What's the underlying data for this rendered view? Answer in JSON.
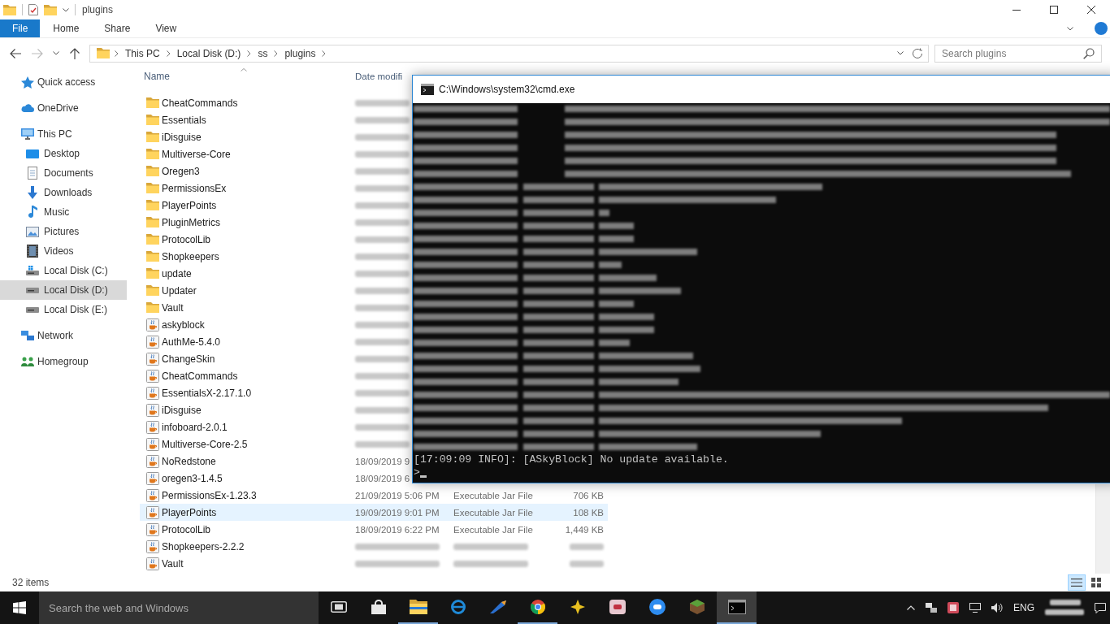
{
  "explorer": {
    "title": "plugins",
    "ribbon_tabs": [
      {
        "label": "File",
        "selected": true
      },
      {
        "label": "Home",
        "selected": false
      },
      {
        "label": "Share",
        "selected": false
      },
      {
        "label": "View",
        "selected": false
      }
    ],
    "address_path": [
      "This PC",
      "Local Disk (D:)",
      "ss",
      "plugins"
    ],
    "search": {
      "placeholder": "Search plugins"
    },
    "navigation": [
      {
        "label": "Quick access",
        "kind": "star",
        "selected": false
      },
      {
        "label": "OneDrive",
        "kind": "cloud",
        "selected": false
      },
      {
        "label": "This PC",
        "kind": "computer",
        "selected": false,
        "children": [
          {
            "label": "Desktop",
            "kind": "desktop",
            "selected": false
          },
          {
            "label": "Documents",
            "kind": "documents",
            "selected": false
          },
          {
            "label": "Downloads",
            "kind": "downloads",
            "selected": false
          },
          {
            "label": "Music",
            "kind": "music",
            "selected": false
          },
          {
            "label": "Pictures",
            "kind": "pictures",
            "selected": false
          },
          {
            "label": "Videos",
            "kind": "videos",
            "selected": false
          },
          {
            "label": "Local Disk (C:)",
            "kind": "system-drive",
            "selected": false
          },
          {
            "label": "Local Disk (D:)",
            "kind": "drive",
            "selected": true
          },
          {
            "label": "Local Disk (E:)",
            "kind": "drive",
            "selected": false
          }
        ]
      },
      {
        "label": "Network",
        "kind": "network",
        "selected": false
      },
      {
        "label": "Homegroup",
        "kind": "homegroup",
        "selected": false
      }
    ],
    "file_list": {
      "columns": [
        "Name",
        "Date modifi"
      ],
      "rows": [
        {
          "name": "CheatCommands",
          "kind": "folder",
          "selected": false
        },
        {
          "name": "Essentials",
          "kind": "folder",
          "selected": false
        },
        {
          "name": "iDisguise",
          "kind": "folder",
          "selected": false
        },
        {
          "name": "Multiverse-Core",
          "kind": "folder",
          "selected": false
        },
        {
          "name": "Oregen3",
          "kind": "folder",
          "selected": false
        },
        {
          "name": "PermissionsEx",
          "kind": "folder",
          "selected": false
        },
        {
          "name": "PlayerPoints",
          "kind": "folder",
          "selected": false
        },
        {
          "name": "PluginMetrics",
          "kind": "folder",
          "selected": false
        },
        {
          "name": "ProtocolLib",
          "kind": "folder",
          "selected": false
        },
        {
          "name": "Shopkeepers",
          "kind": "folder",
          "selected": false
        },
        {
          "name": "update",
          "kind": "folder",
          "selected": false
        },
        {
          "name": "Updater",
          "kind": "folder",
          "selected": false
        },
        {
          "name": "Vault",
          "kind": "folder",
          "selected": false
        },
        {
          "name": "askyblock",
          "kind": "jar",
          "selected": false
        },
        {
          "name": "AuthMe-5.4.0",
          "kind": "jar",
          "selected": false
        },
        {
          "name": "ChangeSkin",
          "kind": "jar",
          "selected": false
        },
        {
          "name": "CheatCommands",
          "kind": "jar",
          "selected": false
        },
        {
          "name": "EssentialsX-2.17.1.0",
          "kind": "jar",
          "selected": false
        },
        {
          "name": "iDisguise",
          "kind": "jar",
          "selected": false
        },
        {
          "name": "infoboard-2.0.1",
          "kind": "jar",
          "selected": false
        },
        {
          "name": "Multiverse-Core-2.5",
          "kind": "jar",
          "selected": false
        },
        {
          "name": "NoRedstone",
          "kind": "jar",
          "selected": false,
          "date_modified": "18/09/2019 9"
        },
        {
          "name": "oregen3-1.4.5",
          "kind": "jar",
          "selected": false,
          "date_modified": "18/09/2019 6"
        },
        {
          "name": "PermissionsEx-1.23.3",
          "kind": "jar",
          "selected": false,
          "date_modified": "21/09/2019 5:06 PM",
          "type": "Executable Jar File",
          "size": "706 KB"
        },
        {
          "name": "PlayerPoints",
          "kind": "jar",
          "selected": true,
          "date_modified": "19/09/2019 9:01 PM",
          "type": "Executable Jar File",
          "size": "108 KB"
        },
        {
          "name": "ProtocolLib",
          "kind": "jar",
          "selected": false,
          "date_modified": "18/09/2019 6:22 PM",
          "type": "Executable Jar File",
          "size": "1,449 KB"
        },
        {
          "name": "Shopkeepers-2.2.2",
          "kind": "jar",
          "selected": false
        },
        {
          "name": "Vault",
          "kind": "jar",
          "selected": false
        }
      ]
    },
    "status": "32 items",
    "view_buttons": [
      {
        "kind": "details",
        "selected": true
      },
      {
        "kind": "large-icons",
        "selected": false
      }
    ]
  },
  "console": {
    "title": "C:\\Windows\\system32\\cmd.exe",
    "lines": [
      "[17:09:09 INFO]: [ASkyBlock] No update available."
    ],
    "prompt": ">"
  },
  "taskbar": {
    "search": {
      "placeholder": "Search the web and Windows"
    },
    "apps": [
      {
        "kind": "task-view",
        "running": false,
        "selected": false
      },
      {
        "kind": "bag",
        "running": false,
        "selected": false
      },
      {
        "kind": "folder",
        "running": true,
        "selected": false
      },
      {
        "kind": "ring",
        "running": false,
        "selected": false
      },
      {
        "kind": "brush",
        "running": false,
        "selected": false
      },
      {
        "kind": "segmented-circle",
        "running": true,
        "selected": false
      },
      {
        "kind": "sparkle",
        "running": false,
        "selected": false
      },
      {
        "kind": "tile",
        "running": false,
        "selected": false
      },
      {
        "kind": "badge",
        "running": false,
        "selected": false
      },
      {
        "kind": "cube",
        "running": false,
        "selected": false
      },
      {
        "kind": "console",
        "running": true,
        "selected": true
      }
    ],
    "language": "ENG"
  }
}
